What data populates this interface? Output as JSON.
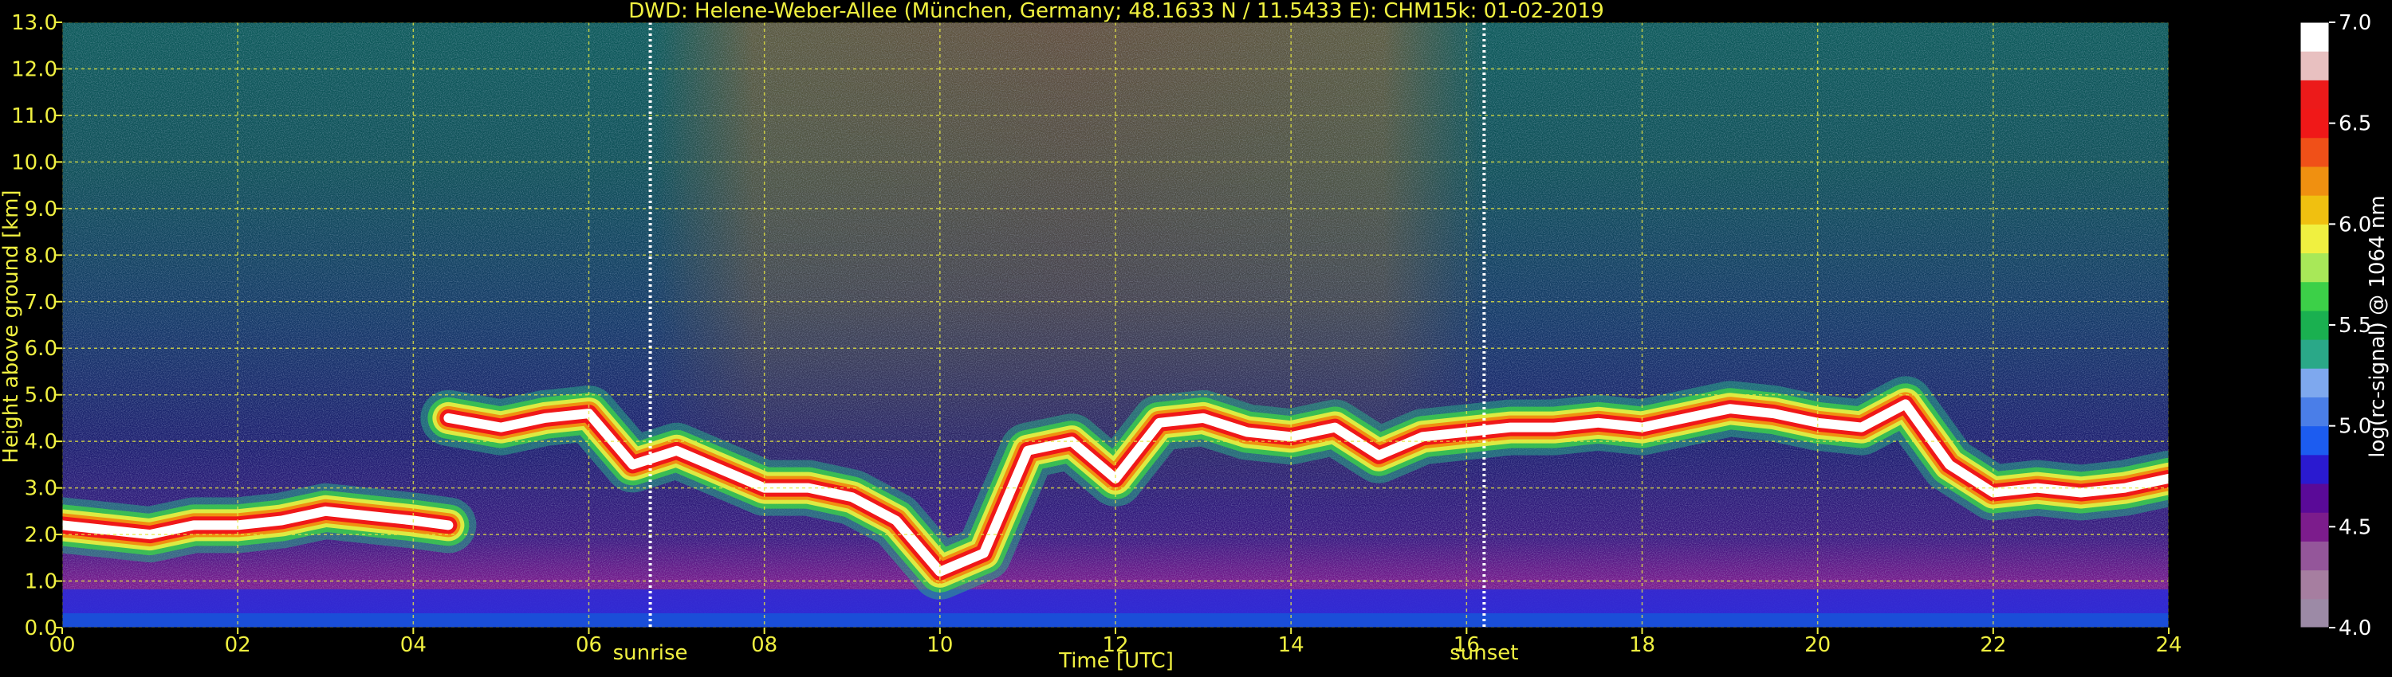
{
  "chart_data": {
    "type": "heatmap",
    "title": "DWD: Helene-Weber-Allee (München, Germany; 48.1633 N / 11.5433 E):    CHM15k: 01-02-2019",
    "xlabel": "Time [UTC]",
    "ylabel": "Height above ground [km]",
    "xlim": [
      0,
      24
    ],
    "ylim": [
      0,
      13
    ],
    "x_ticks": [
      0,
      2,
      4,
      6,
      8,
      10,
      12,
      14,
      16,
      18,
      20,
      22,
      24
    ],
    "x_tick_labels": [
      "00",
      "02",
      "04",
      "06",
      "08",
      "10",
      "12",
      "14",
      "16",
      "18",
      "20",
      "22",
      "24"
    ],
    "y_ticks": [
      0,
      1,
      2,
      3,
      4,
      5,
      6,
      7,
      8,
      9,
      10,
      11,
      12,
      13
    ],
    "y_tick_labels": [
      "0.0",
      "1.0",
      "2.0",
      "3.0",
      "4.0",
      "5.0",
      "6.0",
      "7.0",
      "8.0",
      "9.0",
      "10.0",
      "11.0",
      "12.0",
      "13.0"
    ],
    "grid": true,
    "markers": [
      {
        "label": "sunrise",
        "x": 6.7
      },
      {
        "label": "sunset",
        "x": 16.2
      }
    ],
    "colorbar": {
      "label": "log(rc-signal) @ 1064 nm",
      "range": [
        4.0,
        7.0
      ],
      "ticks": [
        4.0,
        4.5,
        5.0,
        5.5,
        6.0,
        6.5,
        7.0
      ],
      "tick_labels": [
        "4.0",
        "4.5",
        "5.0",
        "5.5",
        "6.0",
        "6.5",
        "7.0"
      ],
      "colors": [
        "#9c8aa6",
        "#a67ea0",
        "#94569a",
        "#7c1c8c",
        "#5a0a98",
        "#2a1ad0",
        "#1c5cf0",
        "#4a7ee8",
        "#7ea8ee",
        "#2aa888",
        "#1ab050",
        "#3cd048",
        "#a8e858",
        "#f0f040",
        "#f0c010",
        "#f09010",
        "#f05018",
        "#f01818",
        "#ec1a1a",
        "#e8c0c0",
        "#ffffff"
      ]
    },
    "layers": {
      "cloud_base_top_km": [
        [
          0,
          2.2
        ],
        [
          0.5,
          2.1
        ],
        [
          1,
          2.0
        ],
        [
          1.5,
          2.2
        ],
        [
          2,
          2.2
        ],
        [
          2.5,
          2.3
        ],
        [
          3,
          2.5
        ],
        [
          3.5,
          2.4
        ],
        [
          4,
          2.3
        ],
        [
          4.4,
          2.2
        ],
        [
          4.4,
          4.5
        ],
        [
          5,
          4.3
        ],
        [
          5.5,
          4.5
        ],
        [
          6,
          4.6
        ],
        [
          6.5,
          3.5
        ],
        [
          7,
          3.8
        ],
        [
          7.5,
          3.4
        ],
        [
          8,
          3.0
        ],
        [
          8.5,
          3.0
        ],
        [
          9,
          2.8
        ],
        [
          9.5,
          2.3
        ],
        [
          10,
          1.2
        ],
        [
          10.5,
          1.6
        ],
        [
          11,
          3.8
        ],
        [
          11.5,
          4.0
        ],
        [
          12,
          3.2
        ],
        [
          12.5,
          4.4
        ],
        [
          13,
          4.5
        ],
        [
          13.5,
          4.2
        ],
        [
          14,
          4.1
        ],
        [
          14.5,
          4.3
        ],
        [
          15,
          3.7
        ],
        [
          15.5,
          4.1
        ],
        [
          16,
          4.2
        ],
        [
          16.5,
          4.3
        ],
        [
          17,
          4.3
        ],
        [
          17.5,
          4.4
        ],
        [
          18,
          4.3
        ],
        [
          18.5,
          4.5
        ],
        [
          19,
          4.7
        ],
        [
          19.5,
          4.6
        ],
        [
          20,
          4.4
        ],
        [
          20.5,
          4.3
        ],
        [
          21,
          4.8
        ],
        [
          21.5,
          3.5
        ],
        [
          22,
          2.9
        ],
        [
          22.5,
          3.0
        ],
        [
          23,
          2.9
        ],
        [
          23.5,
          3.0
        ],
        [
          24,
          3.2
        ]
      ]
    }
  }
}
